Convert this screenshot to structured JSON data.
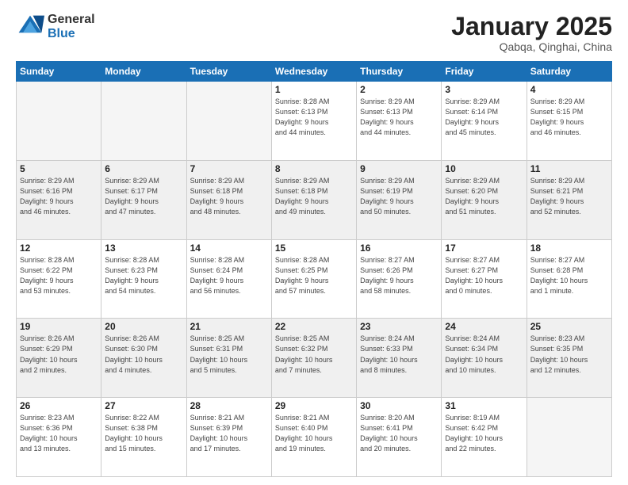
{
  "logo": {
    "general": "General",
    "blue": "Blue"
  },
  "title": "January 2025",
  "subtitle": "Qabqa, Qinghai, China",
  "weekdays": [
    "Sunday",
    "Monday",
    "Tuesday",
    "Wednesday",
    "Thursday",
    "Friday",
    "Saturday"
  ],
  "weeks": [
    [
      {
        "day": "",
        "info": ""
      },
      {
        "day": "",
        "info": ""
      },
      {
        "day": "",
        "info": ""
      },
      {
        "day": "1",
        "info": "Sunrise: 8:28 AM\nSunset: 6:13 PM\nDaylight: 9 hours\nand 44 minutes."
      },
      {
        "day": "2",
        "info": "Sunrise: 8:29 AM\nSunset: 6:13 PM\nDaylight: 9 hours\nand 44 minutes."
      },
      {
        "day": "3",
        "info": "Sunrise: 8:29 AM\nSunset: 6:14 PM\nDaylight: 9 hours\nand 45 minutes."
      },
      {
        "day": "4",
        "info": "Sunrise: 8:29 AM\nSunset: 6:15 PM\nDaylight: 9 hours\nand 46 minutes."
      }
    ],
    [
      {
        "day": "5",
        "info": "Sunrise: 8:29 AM\nSunset: 6:16 PM\nDaylight: 9 hours\nand 46 minutes."
      },
      {
        "day": "6",
        "info": "Sunrise: 8:29 AM\nSunset: 6:17 PM\nDaylight: 9 hours\nand 47 minutes."
      },
      {
        "day": "7",
        "info": "Sunrise: 8:29 AM\nSunset: 6:18 PM\nDaylight: 9 hours\nand 48 minutes."
      },
      {
        "day": "8",
        "info": "Sunrise: 8:29 AM\nSunset: 6:18 PM\nDaylight: 9 hours\nand 49 minutes."
      },
      {
        "day": "9",
        "info": "Sunrise: 8:29 AM\nSunset: 6:19 PM\nDaylight: 9 hours\nand 50 minutes."
      },
      {
        "day": "10",
        "info": "Sunrise: 8:29 AM\nSunset: 6:20 PM\nDaylight: 9 hours\nand 51 minutes."
      },
      {
        "day": "11",
        "info": "Sunrise: 8:29 AM\nSunset: 6:21 PM\nDaylight: 9 hours\nand 52 minutes."
      }
    ],
    [
      {
        "day": "12",
        "info": "Sunrise: 8:28 AM\nSunset: 6:22 PM\nDaylight: 9 hours\nand 53 minutes."
      },
      {
        "day": "13",
        "info": "Sunrise: 8:28 AM\nSunset: 6:23 PM\nDaylight: 9 hours\nand 54 minutes."
      },
      {
        "day": "14",
        "info": "Sunrise: 8:28 AM\nSunset: 6:24 PM\nDaylight: 9 hours\nand 56 minutes."
      },
      {
        "day": "15",
        "info": "Sunrise: 8:28 AM\nSunset: 6:25 PM\nDaylight: 9 hours\nand 57 minutes."
      },
      {
        "day": "16",
        "info": "Sunrise: 8:27 AM\nSunset: 6:26 PM\nDaylight: 9 hours\nand 58 minutes."
      },
      {
        "day": "17",
        "info": "Sunrise: 8:27 AM\nSunset: 6:27 PM\nDaylight: 10 hours\nand 0 minutes."
      },
      {
        "day": "18",
        "info": "Sunrise: 8:27 AM\nSunset: 6:28 PM\nDaylight: 10 hours\nand 1 minute."
      }
    ],
    [
      {
        "day": "19",
        "info": "Sunrise: 8:26 AM\nSunset: 6:29 PM\nDaylight: 10 hours\nand 2 minutes."
      },
      {
        "day": "20",
        "info": "Sunrise: 8:26 AM\nSunset: 6:30 PM\nDaylight: 10 hours\nand 4 minutes."
      },
      {
        "day": "21",
        "info": "Sunrise: 8:25 AM\nSunset: 6:31 PM\nDaylight: 10 hours\nand 5 minutes."
      },
      {
        "day": "22",
        "info": "Sunrise: 8:25 AM\nSunset: 6:32 PM\nDaylight: 10 hours\nand 7 minutes."
      },
      {
        "day": "23",
        "info": "Sunrise: 8:24 AM\nSunset: 6:33 PM\nDaylight: 10 hours\nand 8 minutes."
      },
      {
        "day": "24",
        "info": "Sunrise: 8:24 AM\nSunset: 6:34 PM\nDaylight: 10 hours\nand 10 minutes."
      },
      {
        "day": "25",
        "info": "Sunrise: 8:23 AM\nSunset: 6:35 PM\nDaylight: 10 hours\nand 12 minutes."
      }
    ],
    [
      {
        "day": "26",
        "info": "Sunrise: 8:23 AM\nSunset: 6:36 PM\nDaylight: 10 hours\nand 13 minutes."
      },
      {
        "day": "27",
        "info": "Sunrise: 8:22 AM\nSunset: 6:38 PM\nDaylight: 10 hours\nand 15 minutes."
      },
      {
        "day": "28",
        "info": "Sunrise: 8:21 AM\nSunset: 6:39 PM\nDaylight: 10 hours\nand 17 minutes."
      },
      {
        "day": "29",
        "info": "Sunrise: 8:21 AM\nSunset: 6:40 PM\nDaylight: 10 hours\nand 19 minutes."
      },
      {
        "day": "30",
        "info": "Sunrise: 8:20 AM\nSunset: 6:41 PM\nDaylight: 10 hours\nand 20 minutes."
      },
      {
        "day": "31",
        "info": "Sunrise: 8:19 AM\nSunset: 6:42 PM\nDaylight: 10 hours\nand 22 minutes."
      },
      {
        "day": "",
        "info": ""
      }
    ]
  ],
  "shaded_rows": [
    1,
    3
  ]
}
